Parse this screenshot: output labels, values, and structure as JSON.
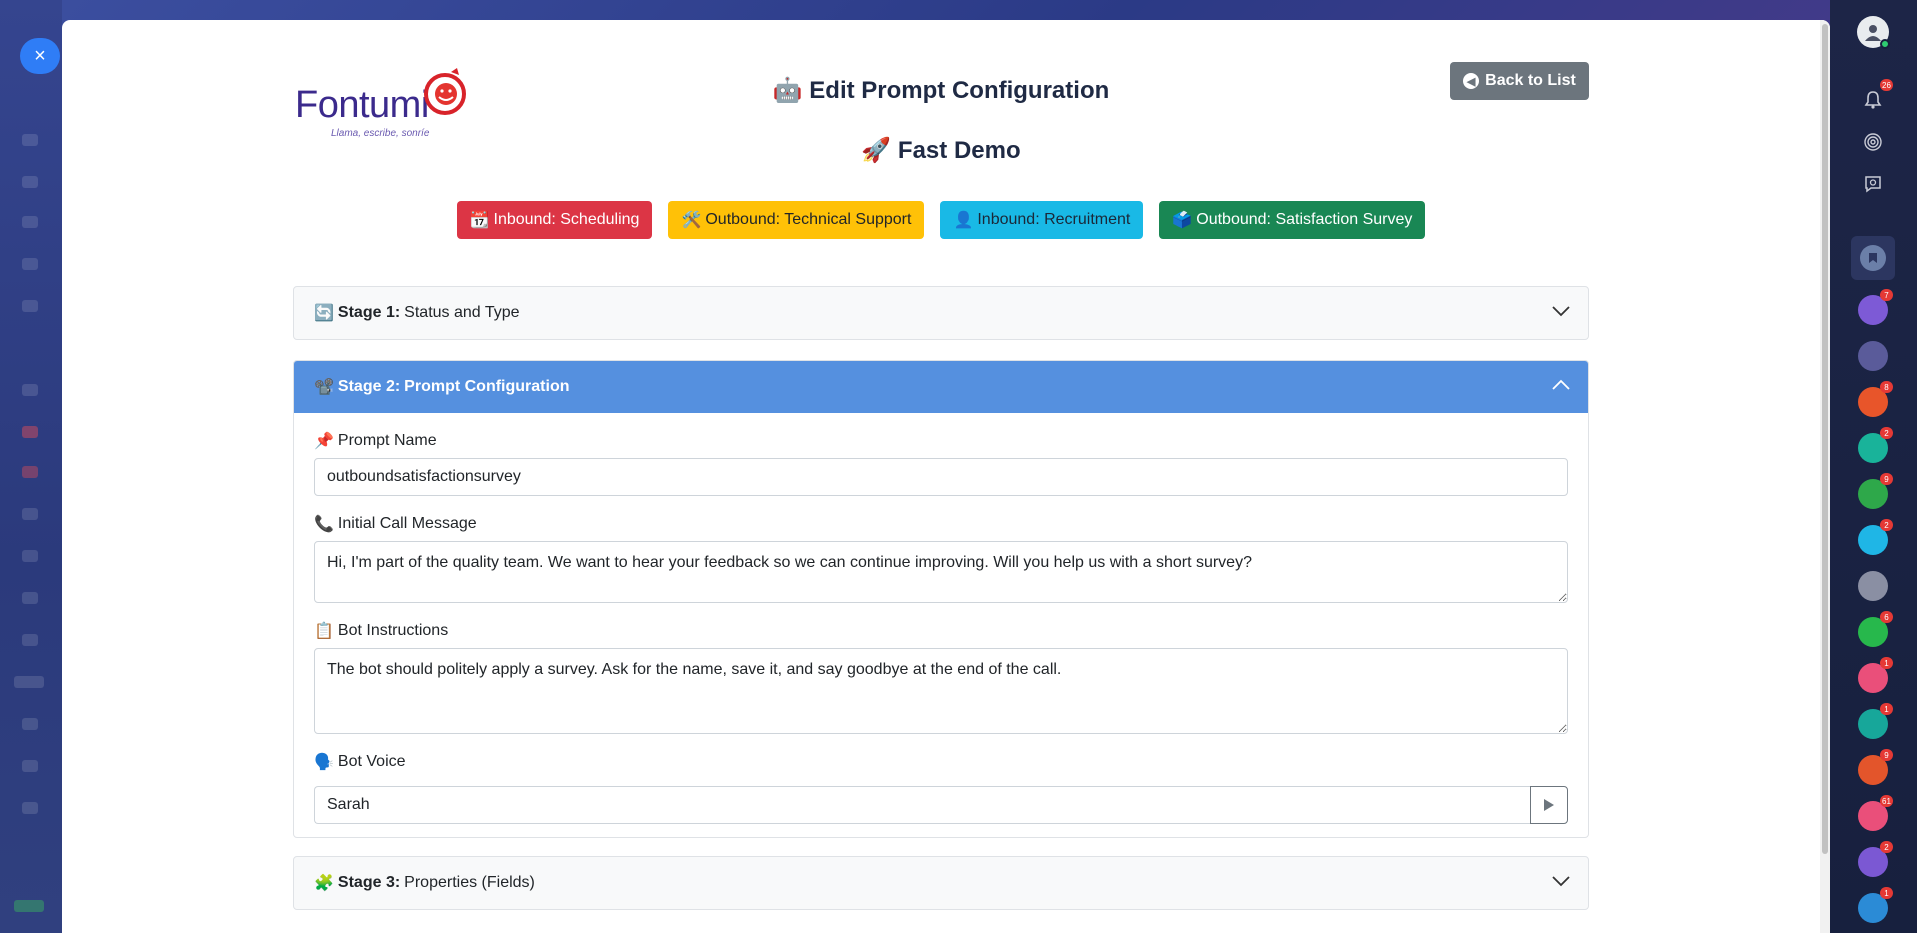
{
  "close": {
    "label": "×"
  },
  "logo": {
    "word": "Fontumi",
    "tagline": "Llama, escribe, sonríe"
  },
  "header": {
    "title_icon": "🤖",
    "title": "Edit Prompt Configuration",
    "subtitle_icon": "🚀",
    "subtitle": "Fast Demo",
    "back_label": "Back to List",
    "back_icon": "arrow-left-circle-icon"
  },
  "templates": [
    {
      "icon": "📆",
      "label": "Inbound: Scheduling",
      "color": "#dc3545"
    },
    {
      "icon": "🛠️",
      "label": "Outbound: Technical Support",
      "color": "#ffc107"
    },
    {
      "icon": "👤",
      "label": "Inbound: Recruitment",
      "color": "#19b9e6"
    },
    {
      "icon": "🗳️",
      "label": "Outbound: Satisfaction Survey",
      "color": "#198754"
    }
  ],
  "stages": [
    {
      "icon": "🔄",
      "number_label": "Stage 1:",
      "title": "Status and Type",
      "expanded": false
    },
    {
      "icon": "📽️",
      "number_label": "Stage 2:",
      "title": "Prompt Configuration",
      "expanded": true,
      "header_color": "#5590df"
    },
    {
      "icon": "🧩",
      "number_label": "Stage 3:",
      "title": "Properties (Fields)",
      "expanded": false
    }
  ],
  "form": {
    "prompt_name": {
      "icon": "📌",
      "label": "Prompt Name",
      "value": "outboundsatisfactionsurvey"
    },
    "initial_message": {
      "icon": "📞",
      "label": "Initial Call Message",
      "value": "Hi, I'm part of the quality team. We want to hear your feedback so we can continue improving. Will you help us with a short survey?"
    },
    "instructions": {
      "icon": "📋",
      "label": "Bot Instructions",
      "value": "The bot should politely apply a survey. Ask for the name, save it, and say goodbye at the end of the call."
    },
    "voice": {
      "icon": "🗣️",
      "label": "Bot Voice",
      "value": "Sarah",
      "play_icon": "play-icon"
    }
  },
  "sidebar": {
    "items": [
      {
        "name": "user-avatar",
        "badge": ""
      },
      {
        "name": "bell-icon",
        "badge": "26"
      },
      {
        "name": "fingerprint-icon",
        "badge": ""
      },
      {
        "name": "chat-search-icon",
        "badge": ""
      },
      {
        "name": "bookmark-icon",
        "badge": ""
      },
      {
        "name": "viber-channel",
        "badge": "7",
        "color": "#7d5ad6"
      },
      {
        "name": "viber-channel",
        "badge": "",
        "color": "#6a5bb5"
      },
      {
        "name": "phone-channel",
        "badge": "8",
        "color": "#e8552a"
      },
      {
        "name": "whatsapp-channel",
        "badge": "2",
        "color": "#19b39a"
      },
      {
        "name": "whatsapp-channel",
        "badge": "9",
        "color": "#2ea84a"
      },
      {
        "name": "chat-channel",
        "badge": "2",
        "color": "#1fb6e6"
      },
      {
        "name": "contact-avatar",
        "badge": "",
        "color": "#8a8fa3"
      },
      {
        "name": "whatsapp-channel",
        "badge": "6",
        "color": "#27b84c"
      },
      {
        "name": "viber-channel",
        "badge": "1",
        "color": "#ea4f7a"
      },
      {
        "name": "whatsapp-channel",
        "badge": "1",
        "color": "#17a79a"
      },
      {
        "name": "phone-channel",
        "badge": "9",
        "color": "#e3552b"
      },
      {
        "name": "viber-channel",
        "badge": "61",
        "color": "#ea4f7a"
      },
      {
        "name": "viber-channel",
        "badge": "2",
        "color": "#7b58d3"
      },
      {
        "name": "whatsapp-channel",
        "badge": "1",
        "color": "#2b8bd6"
      }
    ]
  }
}
